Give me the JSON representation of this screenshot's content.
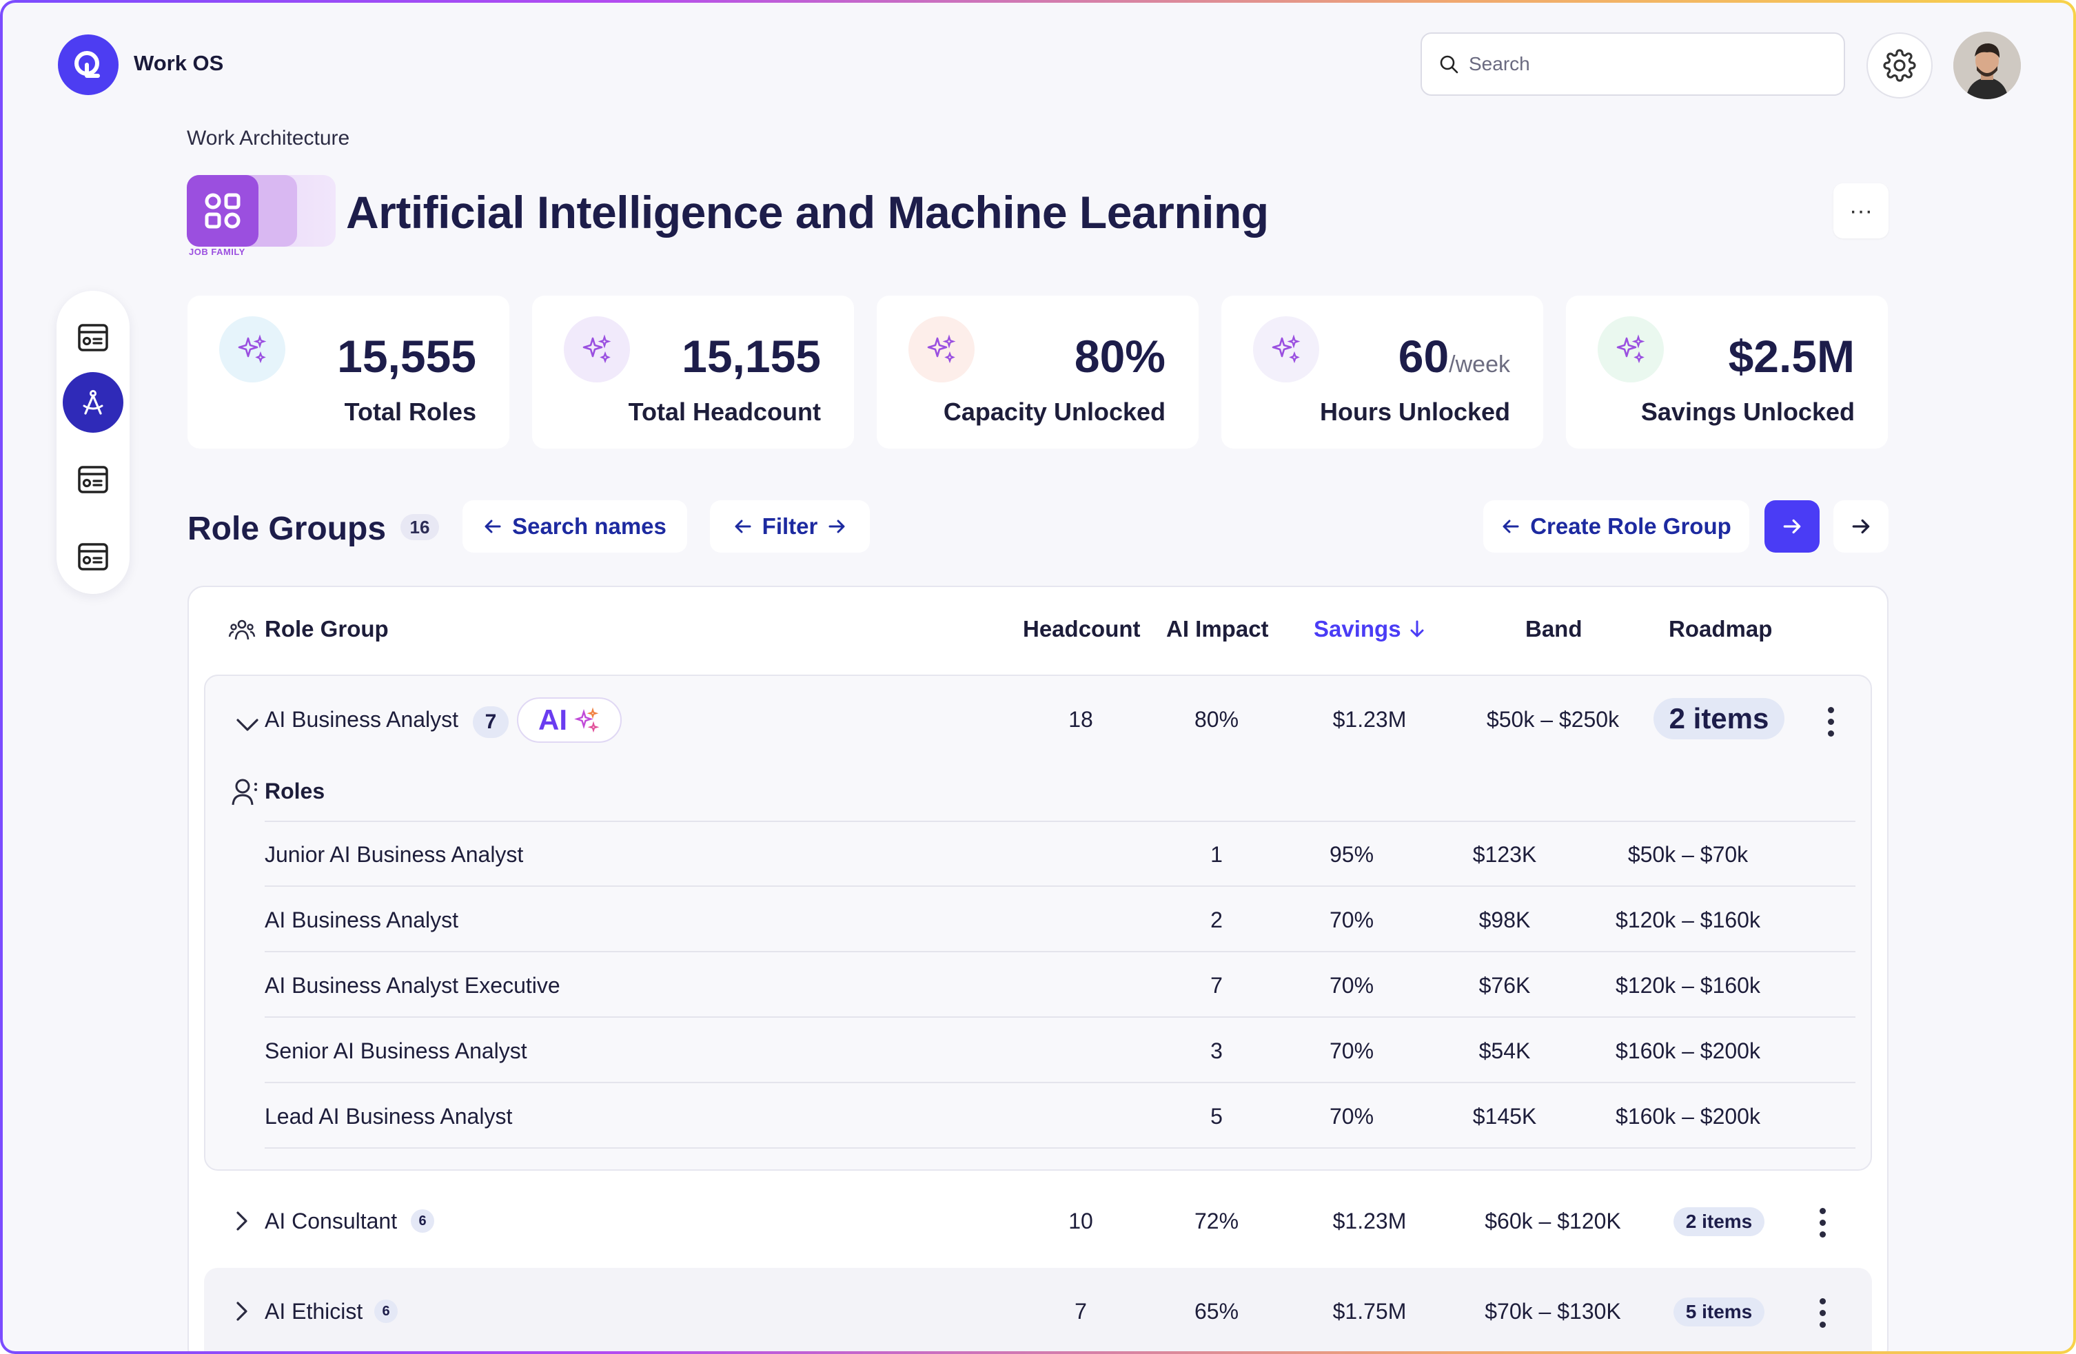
{
  "app": {
    "name": "Work OS"
  },
  "search": {
    "placeholder": "Search"
  },
  "breadcrumb": "Work Architecture",
  "job_family": {
    "badge_label": "JOB FAMILY",
    "title": "Artificial Intelligence and Machine Learning"
  },
  "more_label": "···",
  "stats": [
    {
      "value": "15,555",
      "unit": "",
      "label": "Total Roles",
      "tint": "#e6f4fb"
    },
    {
      "value": "15,155",
      "unit": "",
      "label": "Total Headcount",
      "tint": "#f1eafb"
    },
    {
      "value": "80%",
      "unit": "",
      "label": "Capacity Unlocked",
      "tint": "#fdeeea"
    },
    {
      "value": "60",
      "unit": "/week",
      "label": "Hours Unlocked",
      "tint": "#f3f0fb"
    },
    {
      "value": "$2.5M",
      "unit": "",
      "label": "Savings Unlocked",
      "tint": "#eaf8ef"
    }
  ],
  "role_groups": {
    "title": "Role Groups",
    "count": "16",
    "search_label": "Search names",
    "filter_label": "Filter",
    "create_label": "Create Role Group"
  },
  "table": {
    "headers": {
      "role_group": "Role Group",
      "headcount": "Headcount",
      "ai_impact": "AI Impact",
      "savings": "Savings",
      "band": "Band",
      "roadmap": "Roadmap"
    },
    "expanded_group": {
      "name": "AI Business Analyst",
      "count": "7",
      "ai_tag": "AI",
      "headcount": "18",
      "ai_impact": "80%",
      "savings": "$1.23M",
      "band": "$50k – $250k",
      "roadmap": "2 items",
      "roles_label": "Roles",
      "roles": [
        {
          "name": "Junior AI Business Analyst",
          "headcount": "1",
          "ai_impact": "95%",
          "savings": "$123K",
          "band": "$50k – $70k"
        },
        {
          "name": "AI Business Analyst",
          "headcount": "2",
          "ai_impact": "70%",
          "savings": "$98K",
          "band": "$120k – $160k"
        },
        {
          "name": "AI Business Analyst Executive",
          "headcount": "7",
          "ai_impact": "70%",
          "savings": "$76K",
          "band": "$120k – $160k"
        },
        {
          "name": "Senior AI Business Analyst",
          "headcount": "3",
          "ai_impact": "70%",
          "savings": "$54K",
          "band": "$160k – $200k"
        },
        {
          "name": "Lead AI Business Analyst",
          "headcount": "5",
          "ai_impact": "70%",
          "savings": "$145K",
          "band": "$160k – $200k"
        }
      ]
    },
    "groups": [
      {
        "name": "AI Consultant",
        "count": "6",
        "headcount": "10",
        "ai_impact": "72%",
        "savings": "$1.23M",
        "band": "$60k – $120K",
        "roadmap": "2 items"
      },
      {
        "name": "AI Ethicist",
        "count": "6",
        "headcount": "7",
        "ai_impact": "65%",
        "savings": "$1.75M",
        "band": "$70k – $130K",
        "roadmap": "5 items"
      }
    ]
  },
  "colors": {
    "accent": "#4a3cf5",
    "nav_active": "#2f2ab8",
    "title": "#1d1d4a",
    "sort_active": "#4a3cf5"
  }
}
